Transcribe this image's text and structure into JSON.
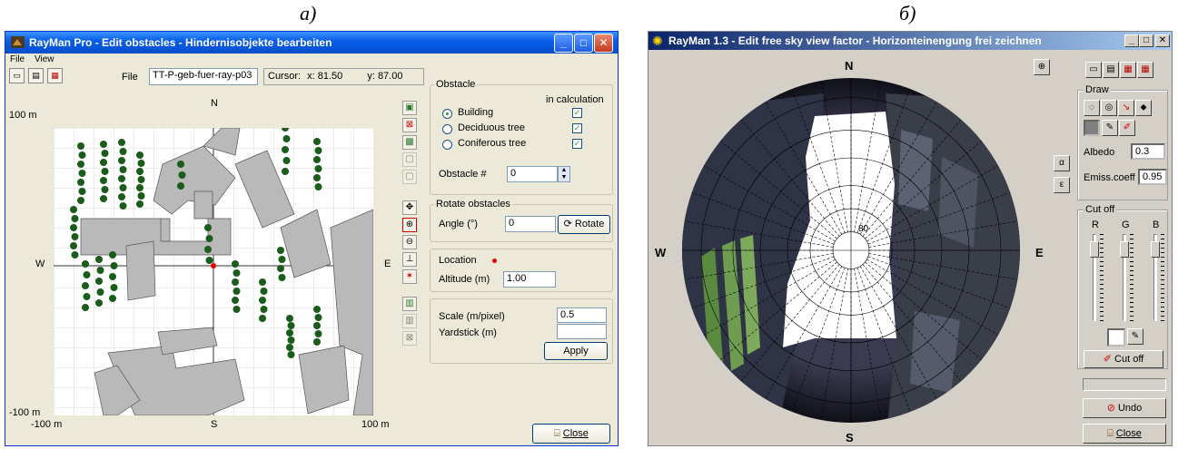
{
  "captions": {
    "left": "а)",
    "right": "б)"
  },
  "winA": {
    "title": "RayMan Pro - Edit obstacles - Hindernisobjekte bearbeiten",
    "menu": {
      "file": "File",
      "view": "View"
    },
    "file_label": "File",
    "file_value": "TT-P-geb-fuer-ray-p03",
    "cursor_label": "Cursor:",
    "cursor_x": "x: 81.50",
    "cursor_y": "y: 87.00",
    "map": {
      "north": "N",
      "south": "S",
      "west": "W",
      "east": "E",
      "y_top": "100 m",
      "y_bottom": "-100 m",
      "x_left": "-100 m",
      "x_right": "100 m"
    },
    "obstacle": {
      "group": "Obstacle",
      "in_calc": "in calculation",
      "building": "Building",
      "deciduous": "Deciduous tree",
      "coniferous": "Coniferous tree",
      "number_label": "Obstacle #",
      "number_value": "0"
    },
    "rotate": {
      "group": "Rotate obstacles",
      "angle_label": "Angle (°)",
      "angle_value": "0",
      "button": "Rotate"
    },
    "location": {
      "label": "Location",
      "altitude_label": "Altitude (m)",
      "altitude_value": "1.00"
    },
    "scale": {
      "scale_label": "Scale (m/pixel)",
      "scale_value": "0.5",
      "yardstick_label": "Yardstick (m)",
      "yardstick_value": "",
      "apply": "Apply"
    },
    "close": "Close",
    "colors": {
      "building": "#b9b9b9",
      "tree": "#1a5c1a",
      "location": "#e00000",
      "titlebar": "#0a5fe8"
    }
  },
  "winB": {
    "title": "RayMan 1.3 - Edit free sky view factor - Horizonteinengung frei zeichnen",
    "compass": {
      "north": "N",
      "south": "S",
      "west": "W",
      "east": "E"
    },
    "sky_ring_label": "80",
    "side_alpha": "α",
    "side_eps": "ε",
    "draw_group": "Draw",
    "albedo_label": "Albedo",
    "albedo_value": "0.3",
    "emiss_label": "Emiss.coeff",
    "emiss_value": "0.95",
    "cutoff_group": "Cut off",
    "rgb": {
      "r": "R",
      "g": "G",
      "b": "B"
    },
    "cutoff_button": "Cut off",
    "undo": "Undo",
    "close": "Close"
  }
}
